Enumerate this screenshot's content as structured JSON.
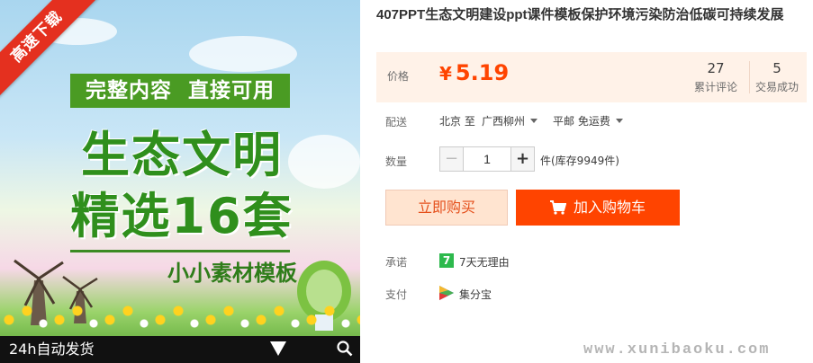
{
  "image": {
    "ribbon": "高速下载",
    "banner_left": "完整内容",
    "banner_right": "直接可用",
    "title_line1": "生态文明",
    "title_line2": "精选16套",
    "subtitle": "小小素材模板",
    "bottom_bar_text": "24h自动发货",
    "icons": [
      "chevron-down-icon",
      "search-icon",
      "windmill-icon"
    ]
  },
  "product": {
    "title": "407PPT生态文明建设ppt课件模板保护环境污染防治低碳可持续发展"
  },
  "price": {
    "label": "价格",
    "currency": "¥",
    "value": "5.19",
    "reviews_count": "27",
    "reviews_label": "累计评论",
    "sales_count": "5",
    "sales_label": "交易成功",
    "accent_color": "#ff4400"
  },
  "shipping": {
    "label": "配送",
    "from": "北京 至",
    "to": "广西柳州",
    "method": "平邮 免运费"
  },
  "quantity": {
    "label": "数量",
    "value": "1",
    "stock": "件(库存9949件)"
  },
  "actions": {
    "buy_now": "立即购买",
    "add_to_cart": "加入购物车"
  },
  "promise": {
    "label": "承诺",
    "icon_text": "7",
    "text": "7天无理由"
  },
  "payment": {
    "label": "支付",
    "text": "集分宝"
  },
  "watermark": "www.xunibaoku.com"
}
